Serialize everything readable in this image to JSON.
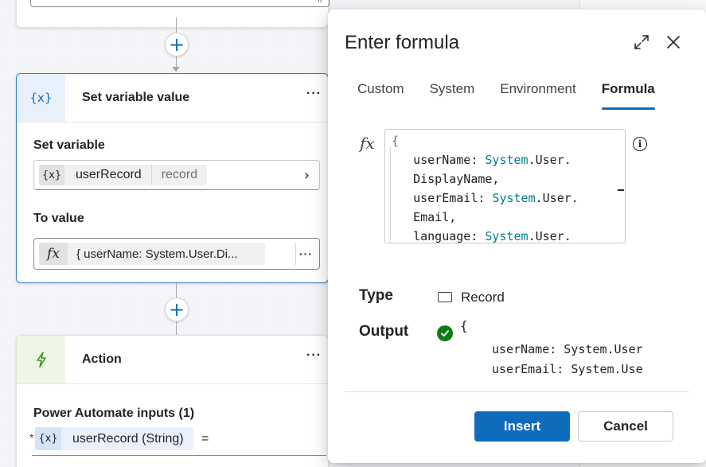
{
  "canvas": {
    "set_variable_card": {
      "icon": "{x}",
      "title": "Set variable value",
      "more": "···",
      "set_variable_label": "Set variable",
      "variable_chip": {
        "icon": "{x}",
        "name": "userRecord",
        "type": "record"
      },
      "to_value_label": "To value",
      "value_chip": {
        "icon": "fx",
        "text": "{ userName: System.User.Di..."
      },
      "value_more": "···"
    },
    "action_card": {
      "icon": "lightning-bolt-icon",
      "title": "Action",
      "more": "···",
      "inputs_label": "Power Automate inputs (1)",
      "required_mark": "*",
      "input_chip": {
        "icon": "{x}",
        "name": "userRecord (String)"
      },
      "equals": "="
    },
    "add_symbol": "+"
  },
  "dialog": {
    "title": "Enter formula",
    "tabs": [
      {
        "label": "Custom",
        "active": false
      },
      {
        "label": "System",
        "active": false
      },
      {
        "label": "Environment",
        "active": false
      },
      {
        "label": "Formula",
        "active": true
      }
    ],
    "fx_label": "fx",
    "type_label": "Type",
    "type_value": "Record",
    "output_label": "Output",
    "output_brace": "{",
    "output_lines": [
      "userName: System.User",
      "userEmail: System.Use"
    ],
    "insert_label": "Insert",
    "cancel_label": "Cancel",
    "info_glyph": "i"
  },
  "colors": {
    "accent": "#0f6cbd",
    "selected_border": "#2f7dc8",
    "success": "#107c10",
    "code_keyword": "#007b8a",
    "required": "#c50f1f"
  }
}
